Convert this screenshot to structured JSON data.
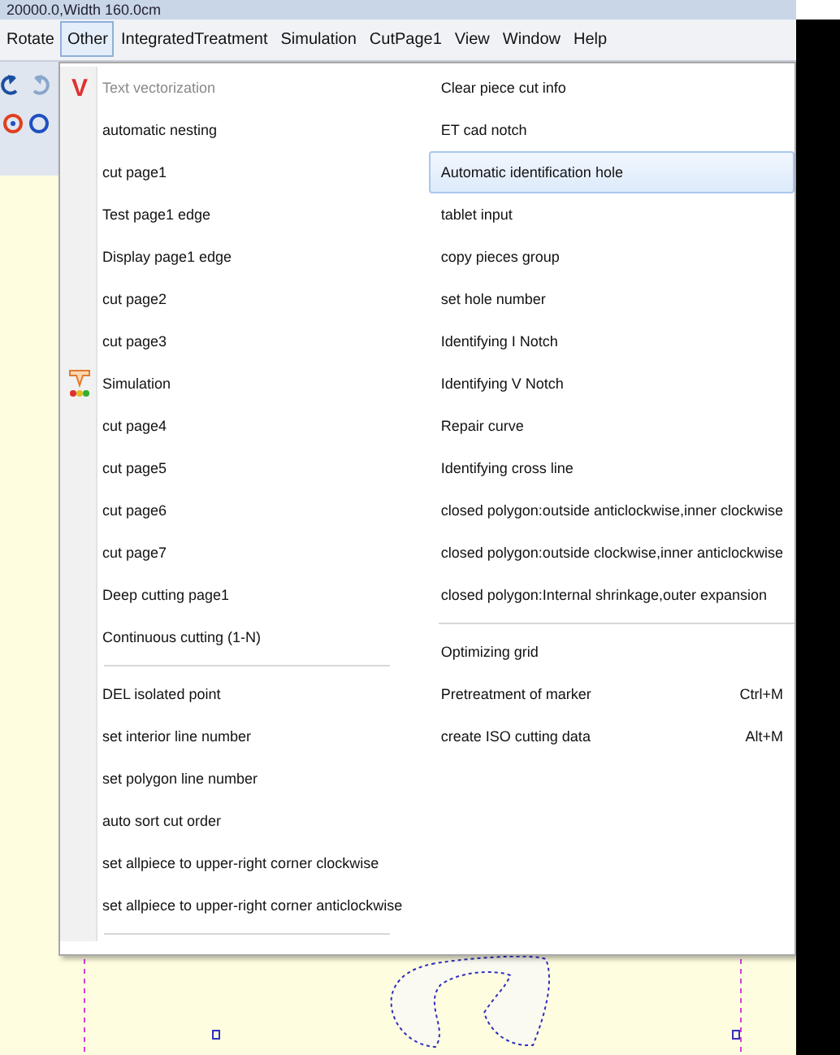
{
  "title_bar": {
    "text": "20000.0,Width 160.0cm"
  },
  "menu_bar": [
    {
      "label": "Rotate",
      "selected": false
    },
    {
      "label": "Other",
      "selected": true
    },
    {
      "label": "IntegratedTreatment",
      "selected": false
    },
    {
      "label": "Simulation",
      "selected": false
    },
    {
      "label": "CutPage1",
      "selected": false
    },
    {
      "label": "View",
      "selected": false
    },
    {
      "label": "Window",
      "selected": false
    },
    {
      "label": "Help",
      "selected": false
    }
  ],
  "menu": {
    "left_column": [
      {
        "label": "Text vectorization",
        "kind": "glyph",
        "glyph": "V",
        "disabled": true,
        "separator_after": false
      },
      {
        "label": "automatic nesting",
        "kind": "plain",
        "disabled": false,
        "separator_after": false
      },
      {
        "label": "cut page1",
        "kind": "plain",
        "disabled": false,
        "separator_after": false
      },
      {
        "label": "Test page1 edge",
        "kind": "plain",
        "disabled": false,
        "separator_after": false
      },
      {
        "label": "Display page1 edge",
        "kind": "plain",
        "disabled": false,
        "separator_after": false
      },
      {
        "label": "cut page2",
        "kind": "plain",
        "disabled": false,
        "separator_after": false
      },
      {
        "label": "cut page3",
        "kind": "plain",
        "disabled": false,
        "separator_after": false
      },
      {
        "label": "Simulation",
        "kind": "tool",
        "disabled": false,
        "separator_after": false
      },
      {
        "label": "cut page4",
        "kind": "plain",
        "disabled": false,
        "separator_after": false
      },
      {
        "label": "cut page5",
        "kind": "plain",
        "disabled": false,
        "separator_after": false
      },
      {
        "label": "cut page6",
        "kind": "plain",
        "disabled": false,
        "separator_after": false
      },
      {
        "label": "cut page7",
        "kind": "plain",
        "disabled": false,
        "separator_after": false
      },
      {
        "label": "Deep cutting page1",
        "kind": "plain",
        "disabled": false,
        "separator_after": false
      },
      {
        "label": "Continuous cutting (1-N)",
        "kind": "plain",
        "disabled": false,
        "separator_after": true
      },
      {
        "label": "DEL isolated point",
        "kind": "plain",
        "disabled": false,
        "separator_after": false
      },
      {
        "label": "set interior line number",
        "kind": "plain",
        "disabled": false,
        "separator_after": false
      },
      {
        "label": "set polygon line number",
        "kind": "plain",
        "disabled": false,
        "separator_after": false
      },
      {
        "label": "auto sort cut order",
        "kind": "plain",
        "disabled": false,
        "separator_after": false
      },
      {
        "label": "set allpiece to upper-right corner clockwise",
        "kind": "plain",
        "disabled": false,
        "separator_after": false
      },
      {
        "label": "set allpiece to upper-right corner anticlockwise",
        "kind": "plain",
        "disabled": false,
        "separator_after": true
      }
    ],
    "right_column": [
      {
        "label": "Clear piece cut info",
        "selected": false,
        "separator_after": false
      },
      {
        "label": "ET cad notch",
        "selected": false,
        "separator_after": false
      },
      {
        "label": "Automatic identification hole",
        "selected": true,
        "separator_after": false
      },
      {
        "label": "tablet input",
        "selected": false,
        "separator_after": false
      },
      {
        "label": "copy pieces group",
        "selected": false,
        "separator_after": false
      },
      {
        "label": "set hole number",
        "selected": false,
        "separator_after": false
      },
      {
        "label": "Identifying I Notch",
        "selected": false,
        "separator_after": false
      },
      {
        "label": "Identifying V Notch",
        "selected": false,
        "separator_after": false
      },
      {
        "label": "Repair curve",
        "selected": false,
        "separator_after": false
      },
      {
        "label": "Identifying cross line",
        "selected": false,
        "separator_after": false
      },
      {
        "label": "closed polygon:outside anticlockwise,inner clockwise",
        "selected": false,
        "separator_after": false
      },
      {
        "label": "closed polygon:outside clockwise,inner anticlockwise",
        "selected": false,
        "separator_after": false
      },
      {
        "label": "closed polygon:Internal shrinkage,outer expansion",
        "selected": false,
        "separator_after": true
      },
      {
        "label": "Optimizing grid",
        "selected": false,
        "separator_after": false
      },
      {
        "label": "Pretreatment of marker",
        "shortcut": "Ctrl+M",
        "selected": false,
        "separator_after": false
      },
      {
        "label": "create ISO cutting data",
        "shortcut": "Alt+M",
        "selected": false,
        "separator_after": false
      }
    ]
  }
}
